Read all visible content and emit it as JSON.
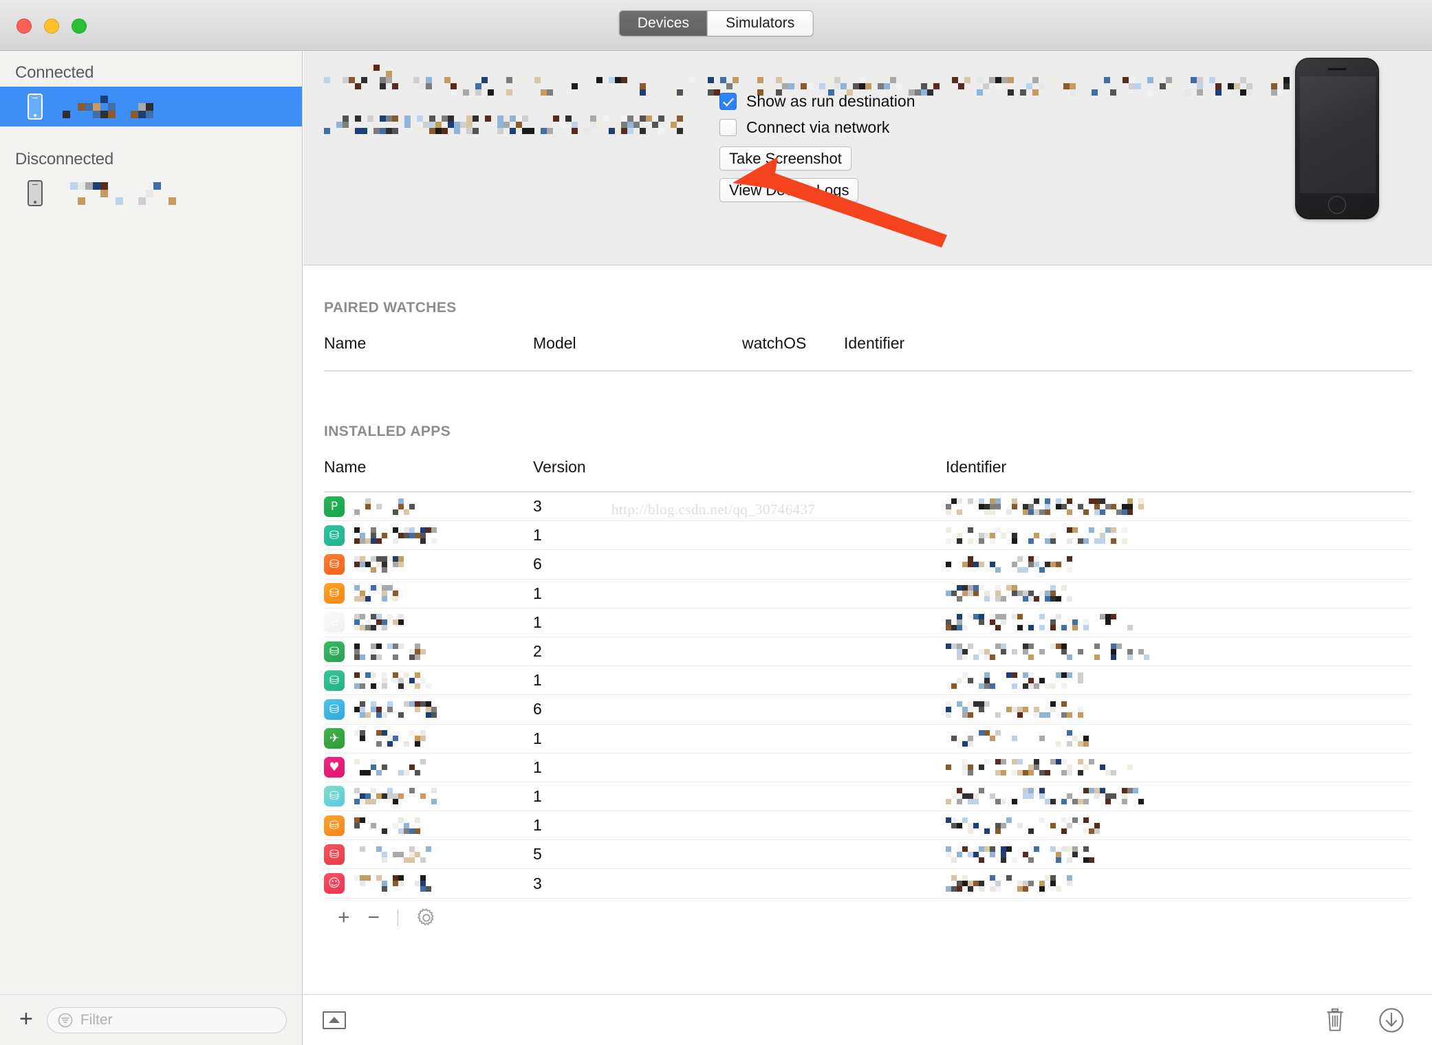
{
  "window": {
    "traffic_lights": [
      "close",
      "minimize",
      "maximize"
    ],
    "segmented_control": {
      "options": [
        "Devices",
        "Simulators"
      ],
      "selected": "Devices"
    }
  },
  "sidebar": {
    "sections": [
      {
        "header": "Connected",
        "items": [
          {
            "name_redacted": true,
            "icon": "iphone-icon",
            "selected": true
          }
        ]
      },
      {
        "header": "Disconnected",
        "items": [
          {
            "name_redacted": true,
            "icon": "iphone-icon",
            "selected": false
          }
        ]
      }
    ],
    "add_button_label": "+",
    "filter": {
      "placeholder": "Filter",
      "value": "",
      "icon": "filter-icon"
    }
  },
  "device_detail": {
    "name_redacted": true,
    "info_lines_redacted": 5,
    "options": [
      {
        "label": "Show as run destination",
        "checked": true
      },
      {
        "label": "Connect via network",
        "checked": false
      }
    ],
    "buttons": [
      {
        "label": "Take Screenshot"
      },
      {
        "label": "View Device Logs"
      }
    ],
    "device_image": "iphone-black-render",
    "annotation": {
      "type": "red-arrow",
      "color": "#f5431d",
      "points_at": "Connect via network"
    }
  },
  "paired_watches": {
    "title": "PAIRED WATCHES",
    "columns": [
      "Name",
      "Model",
      "watchOS",
      "Identifier"
    ],
    "rows": []
  },
  "installed_apps": {
    "title": "INSTALLED APPS",
    "columns": [
      "Name",
      "Version",
      "Identifier"
    ],
    "rows": [
      {
        "version": "3",
        "icon_color1": "#2bb55a",
        "icon_color2": "#16a34a",
        "glyph": "P",
        "name_redacted": true,
        "identifier_redacted": true
      },
      {
        "version": "1",
        "icon_color1": "#32c3a0",
        "icon_color2": "#20b08d",
        "glyph": "⛁",
        "name_redacted": true,
        "identifier_redacted": true
      },
      {
        "version": "6",
        "icon_color1": "#fb7e2d",
        "icon_color2": "#f4621f",
        "glyph": "⛁",
        "name_redacted": true,
        "identifier_redacted": true
      },
      {
        "version": "1",
        "icon_color1": "#ffa320",
        "icon_color2": "#f9861a",
        "glyph": "⛁",
        "name_redacted": true,
        "identifier_redacted": true
      },
      {
        "version": "1",
        "icon_color1": "#fcfcfc",
        "icon_color2": "#efefef",
        "glyph": "e",
        "name_redacted": true,
        "identifier_redacted": true
      },
      {
        "version": "2",
        "icon_color1": "#3ab864",
        "icon_color2": "#28a352",
        "glyph": "⛁",
        "name_redacted": true,
        "identifier_redacted": true
      },
      {
        "version": "1",
        "icon_color1": "#38c59a",
        "icon_color2": "#22b184",
        "glyph": "⛁",
        "name_redacted": true,
        "identifier_redacted": true
      },
      {
        "version": "6",
        "icon_color1": "#4fc3e8",
        "icon_color2": "#2ea8dd",
        "glyph": "⛁",
        "name_redacted": true,
        "identifier_redacted": true
      },
      {
        "version": "1",
        "icon_color1": "#45b24b",
        "icon_color2": "#2d9a38",
        "glyph": "✈",
        "name_redacted": true,
        "identifier_redacted": true
      },
      {
        "version": "1",
        "icon_color1": "#f0267f",
        "icon_color2": "#e0156f",
        "glyph": "♥",
        "name_redacted": true,
        "identifier_redacted": true
      },
      {
        "version": "1",
        "icon_color1": "#7fe0c4",
        "icon_color2": "#59c9df",
        "glyph": "⛁",
        "name_redacted": true,
        "identifier_redacted": true
      },
      {
        "version": "1",
        "icon_color1": "#fca52c",
        "icon_color2": "#f6821d",
        "glyph": "⛁",
        "name_redacted": true,
        "identifier_redacted": true
      },
      {
        "version": "5",
        "icon_color1": "#f2565b",
        "icon_color2": "#e63c47",
        "glyph": "⛁",
        "name_redacted": true,
        "identifier_redacted": true
      },
      {
        "version": "3",
        "icon_color1": "#fb4f63",
        "icon_color2": "#ef3350",
        "glyph": "☺",
        "name_redacted": true,
        "identifier_redacted": true
      }
    ],
    "toolbar": {
      "add": "+",
      "remove": "−",
      "settings": "gear-icon"
    }
  },
  "bottom_bar": {
    "eject": "eject-icon",
    "trash": "trash-icon",
    "download": "download-icon"
  },
  "watermark": "http://blog.csdn.net/qq_30746437"
}
